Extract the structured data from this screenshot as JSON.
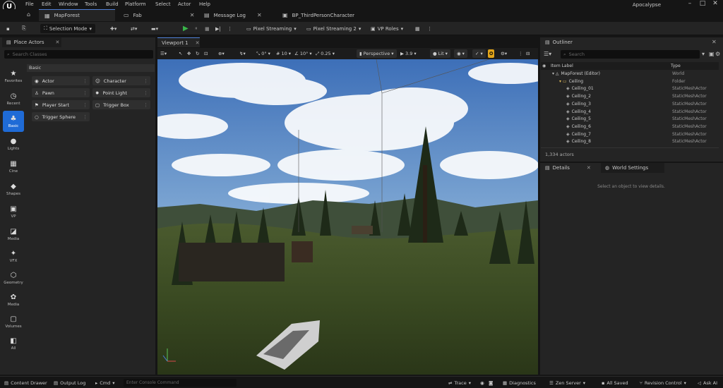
{
  "menu": [
    "File",
    "Edit",
    "Window",
    "Tools",
    "Build",
    "Platform",
    "Select",
    "Actor",
    "Help"
  ],
  "user": "Apocalypse",
  "tabs": [
    {
      "label": "MapForest",
      "active": true
    },
    {
      "label": "Fab",
      "active": false
    },
    {
      "label": "Message Log",
      "active": false
    },
    {
      "label": "BP_ThirdPersonCharacter",
      "active": false
    }
  ],
  "toolbar": {
    "mode": "Selection Mode",
    "pixel_streaming": "Pixel Streaming",
    "pixel_streaming2": "Pixel Streaming 2",
    "vp_roles": "VP Roles"
  },
  "place_actors": {
    "tab": "Place Actors",
    "search_placeholder": "Search Classes",
    "categories": [
      "Favorites",
      "Recent",
      "Basic",
      "Lights",
      "Cine",
      "Shapes",
      "VP",
      "Media",
      "VFX",
      "Geometry",
      "Media",
      "Volumes",
      "All"
    ],
    "basic_header": "Basic",
    "actors": [
      "Actor",
      "Character",
      "Pawn",
      "Point Light",
      "Player Start",
      "Trigger Box",
      "Trigger Sphere"
    ]
  },
  "viewport": {
    "tab": "Viewport 1",
    "perspective": "Perspective",
    "lit": "Lit",
    "grid_snap": "10",
    "rot_snap": "10°",
    "scale_snap": "0.25",
    "cam_speed": "3.9",
    "snap_angle": "0°"
  },
  "outliner": {
    "tab": "Outliner",
    "search_placeholder": "Search",
    "col_label": "Item Label",
    "col_type": "Type",
    "rows": [
      {
        "label": "MapForest (Editor)",
        "type": "World",
        "indent": 0
      },
      {
        "label": "Ceiling",
        "type": "Folder",
        "indent": 1
      },
      {
        "label": "Ceiling_01",
        "type": "StaticMeshActor",
        "indent": 2
      },
      {
        "label": "Ceiling_2",
        "type": "StaticMeshActor",
        "indent": 2
      },
      {
        "label": "Ceiling_3",
        "type": "StaticMeshActor",
        "indent": 2
      },
      {
        "label": "Ceiling_4",
        "type": "StaticMeshActor",
        "indent": 2
      },
      {
        "label": "Ceiling_5",
        "type": "StaticMeshActor",
        "indent": 2
      },
      {
        "label": "Ceiling_6",
        "type": "StaticMeshActor",
        "indent": 2
      },
      {
        "label": "Ceiling_7",
        "type": "StaticMeshActor",
        "indent": 2
      },
      {
        "label": "Ceiling_8",
        "type": "StaticMeshActor",
        "indent": 2
      }
    ],
    "count": "1,334 actors"
  },
  "details": {
    "tab": "Details",
    "world_settings_tab": "World Settings",
    "empty_msg": "Select an object to view details."
  },
  "status": {
    "content_drawer": "Content Drawer",
    "output_log": "Output Log",
    "cmd": "Cmd",
    "console_placeholder": "Enter Console Command",
    "trace": "Trace",
    "diagnostics": "Diagnostics",
    "zen": "Zen Server",
    "saved": "All Saved",
    "revision": "Revision Control",
    "ask_ai": "Ask AI"
  },
  "colors": {
    "accent": "#1f6bd6",
    "play": "#39b54a",
    "panel": "#242424"
  }
}
